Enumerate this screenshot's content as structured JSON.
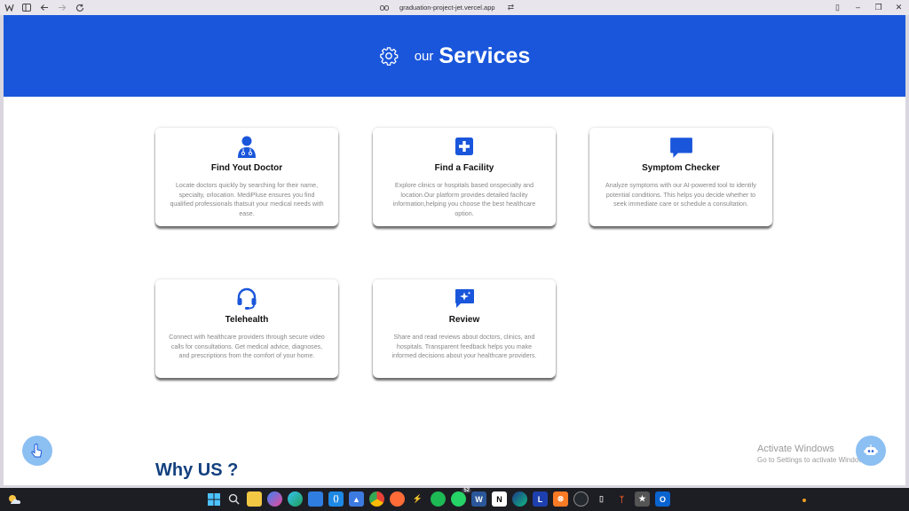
{
  "browser": {
    "url": "graduation-project-jet.vercel.app",
    "nav_icons": [
      "app-menu-icon",
      "sidebar-icon",
      "back-arrow-icon",
      "forward-arrow-icon",
      "reload-icon"
    ]
  },
  "hero": {
    "prefix": "our",
    "title": "Services",
    "background": "#1a56db"
  },
  "services": [
    {
      "icon": "doctor-icon",
      "title": "Find Yout Doctor",
      "description": "Locate doctors quickly by searching for their name, specialty, orlocation. MediPluse ensures you find qualified professionals thatsuit your medical needs with ease."
    },
    {
      "icon": "hospital-plus-icon",
      "title": "Find a Facility",
      "description": "Explore clinics or hospitals based onspecialty and location.Our platform provides detailed facility information,helping you choose the best healthcare option."
    },
    {
      "icon": "chat-bubble-icon",
      "title": "Symptom Checker",
      "description": "Analyze symptoms with our AI-powered tool to identify potential conditions. This helps you decide whether to seek immediate care or schedule a consultation."
    },
    {
      "icon": "headset-icon",
      "title": "Telehealth",
      "description": "Connect with healthcare providers through secure video calls for consultations. Get medical advice, diagnoses, and prescriptions from the comfort of your home."
    },
    {
      "icon": "review-star-icon",
      "title": "Review",
      "description": "Share and read reviews about doctors, clinics, and hospitals. Transparent feedback helps you make informed decisions about your healthcare providers."
    }
  ],
  "why_us": {
    "title": "Why US ?"
  },
  "activate_windows": {
    "line1": "Activate Windows",
    "line2": "Go to Settings to activate Windows."
  },
  "taskbar": {
    "whatsapp_badge": "52",
    "icons": [
      "windows-start-icon",
      "search-icon",
      "file-explorer-icon",
      "copilot-icon",
      "edge-icon",
      "store-icon",
      "vscode-icon",
      "app-icon",
      "chrome-icon",
      "postman-icon",
      "app-icon",
      "spotify-icon",
      "whatsapp-icon",
      "word-icon",
      "notion-icon",
      "edge-dev-icon",
      "l-app-icon",
      "xampp-icon",
      "github-icon",
      "phone-link-icon",
      "app-icon",
      "browser-icon",
      "outlook-icon"
    ]
  },
  "colors": {
    "accent": "#1a56db",
    "heading": "#13407f",
    "fab": "#8cbff2"
  }
}
